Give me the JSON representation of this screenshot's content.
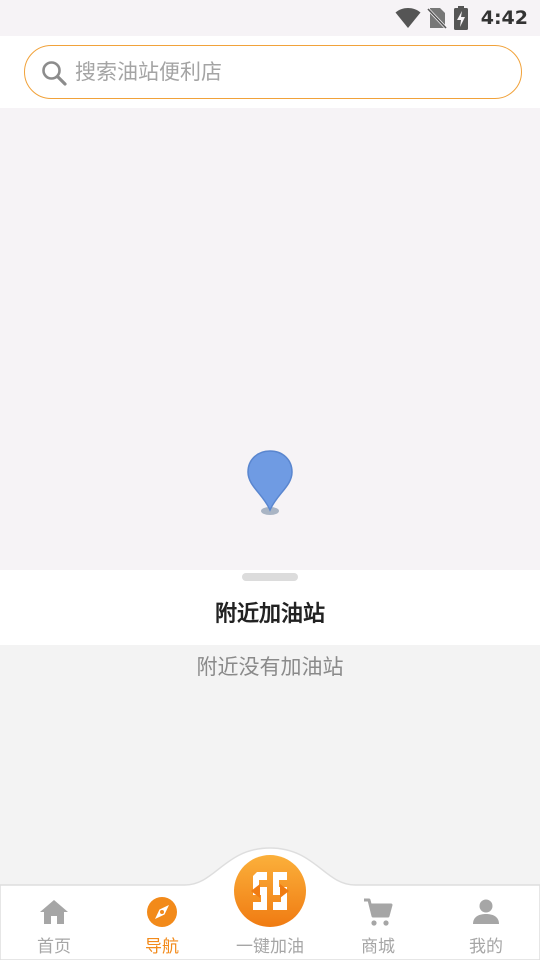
{
  "status_bar": {
    "time": "4:42",
    "icons": [
      "wifi-icon",
      "no-sim-icon",
      "battery-charging-icon"
    ]
  },
  "search": {
    "placeholder": "搜索油站便利店",
    "value": "",
    "accent_color": "#f1a23a"
  },
  "map": {
    "background": "#f6f3f6",
    "pin_color": "#6f9be3",
    "icons": [
      "location-pin-icon"
    ]
  },
  "panel": {
    "title": "附近加油站",
    "empty_message": "附近没有加油站"
  },
  "tabbar": {
    "active_color": "#f28a1a",
    "inactive_color": "#a6a6a6",
    "tabs": [
      {
        "label": "首页",
        "icon": "home-icon",
        "active": false
      },
      {
        "label": "导航",
        "icon": "compass-icon",
        "active": true
      },
      {
        "label": "一键加油",
        "icon": "logo-icon",
        "active": false
      },
      {
        "label": "商城",
        "icon": "cart-icon",
        "active": false
      },
      {
        "label": "我的",
        "icon": "person-icon",
        "active": false
      }
    ]
  }
}
